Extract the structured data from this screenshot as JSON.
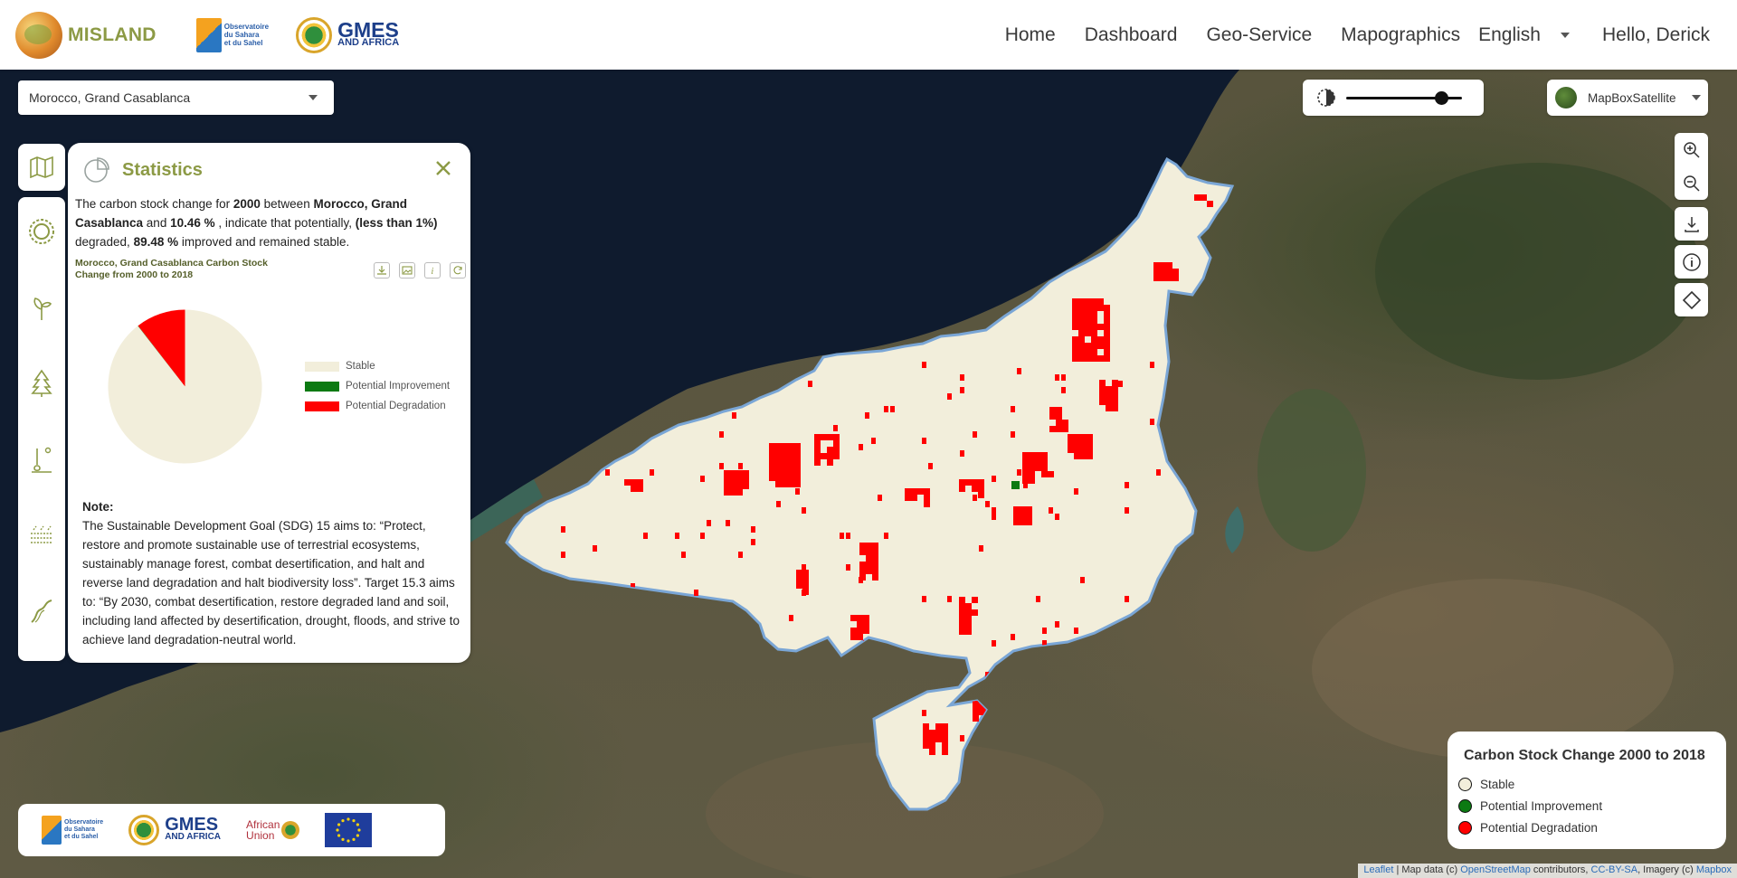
{
  "header": {
    "brand": "MISLAND",
    "partner_oss_lines": [
      "Observatoire",
      "du Sahara",
      "et du Sahel"
    ],
    "partner_gmes_big": "GMES",
    "partner_gmes_small": "AND AFRICA",
    "nav": [
      "Home",
      "Dashboard",
      "Geo-Service",
      "Mapographics"
    ],
    "language": "English",
    "greeting": "Hello, Derick"
  },
  "region_select": {
    "value": "Morocco, Grand Casablanca"
  },
  "tool_rail": {
    "top_icon": "map-icon",
    "items": [
      "land-degradation-icon",
      "vegetation-icon",
      "forest-icon",
      "climate-icon",
      "soil-icon",
      "erosion-icon"
    ]
  },
  "statistics": {
    "title": "Statistics",
    "desc_pre": "The carbon stock change for ",
    "desc_year": "2000",
    "desc_between": " between ",
    "desc_region": "Morocco, Grand Casablanca",
    "desc_and": " and ",
    "desc_pct1": "10.46 %",
    "desc_mid": " , indicate that potentially, ",
    "desc_less": "(less than 1%)",
    "desc_deg": " degraded, ",
    "desc_pct2": "89.48 %",
    "desc_end": " improved and remained stable.",
    "chart_title": "Morocco, Grand Casablanca Carbon Stock Change from 2000 to 2018",
    "chart_tools": [
      "download-icon",
      "image-icon",
      "info-icon",
      "refresh-icon"
    ],
    "note_title": "Note:",
    "note_text": "The Sustainable Development Goal (SDG) 15 aims to: “Protect, restore and promote sustainable use of terrestrial ecosystems, sustainably manage forest, combat desertification, and halt and reverse land degradation and halt biodiversity loss”. Target 15.3 aims to: “By 2030, combat desertification, restore degraded land and soil, including land affected by desertification, drought, floods, and strive to achieve land degradation-neutral world."
  },
  "chart_data": {
    "type": "pie",
    "title": "Morocco, Grand Casablanca Carbon Stock Change from 2000 to 2018",
    "categories": [
      "Stable",
      "Potential Improvement",
      "Potential Degradation"
    ],
    "values": [
      89.48,
      0.06,
      10.46
    ],
    "colors": [
      "#f2eedb",
      "#0c7a12",
      "#ff0000"
    ],
    "legend_position": "right"
  },
  "opacity": {
    "value": 0.82
  },
  "basemap": {
    "value": "MapBoxSatellite"
  },
  "map_controls": [
    "zoom-in-icon",
    "zoom-out-icon",
    "download-icon",
    "info-icon",
    "draw-polygon-icon"
  ],
  "map_legend": {
    "title": "Carbon Stock Change 2000 to 2018",
    "items": [
      {
        "label": "Stable",
        "color": "#f2eedb"
      },
      {
        "label": "Potential Improvement",
        "color": "#0c7a12"
      },
      {
        "label": "Potential Degradation",
        "color": "#ff0000"
      }
    ]
  },
  "partners": {
    "oss_lines": [
      "Observatoire",
      "du Sahara",
      "et du Sahel"
    ],
    "gmes_big": "GMES",
    "gmes_small": "AND AFRICA",
    "au_lines": [
      "African",
      "Union"
    ]
  },
  "attribution": {
    "leaflet": "Leaflet",
    "text1": " | Map data (c) ",
    "osm": "OpenStreetMap",
    "text2": " contributors, ",
    "license": "CC-BY-SA",
    "text3": ", Imagery (c) ",
    "mapbox": "Mapbox"
  }
}
